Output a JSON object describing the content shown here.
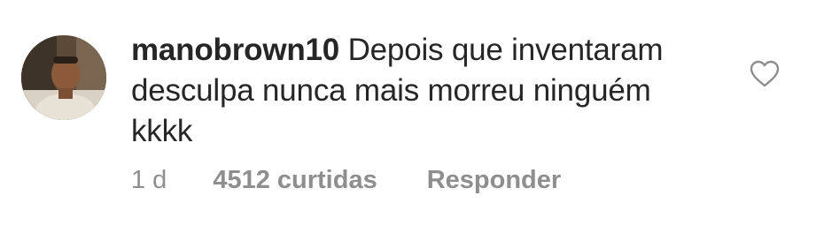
{
  "comment": {
    "username": "manobrown10",
    "text": "Depois que inventaram desculpa nunca mais morreu ninguém kkkk",
    "time": "1 d",
    "likes": "4512 curtidas",
    "reply_label": "Responder",
    "avatar_icon": "user-avatar-photo",
    "like_icon": "heart-outline-icon"
  },
  "colors": {
    "text": "#262626",
    "muted": "#8e8e8e",
    "background": "#ffffff"
  }
}
